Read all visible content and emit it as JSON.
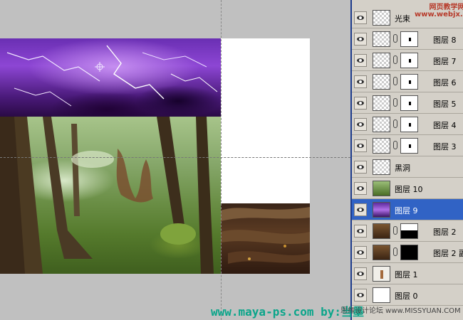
{
  "workspace": {
    "document": "layered composition canvas"
  },
  "layers_panel": {
    "layers": [
      {
        "name": "光束",
        "thumb": "checker",
        "has_mask": false
      },
      {
        "name": "图层 8",
        "thumb": "checker",
        "has_mask": true,
        "mask": "dot"
      },
      {
        "name": "图层 7",
        "thumb": "checker",
        "has_mask": true,
        "mask": "dot"
      },
      {
        "name": "图层 6",
        "thumb": "checker",
        "has_mask": true,
        "mask": "dot"
      },
      {
        "name": "图层 5",
        "thumb": "checker",
        "has_mask": true,
        "mask": "dot"
      },
      {
        "name": "图层 4",
        "thumb": "checker",
        "has_mask": true,
        "mask": "dot"
      },
      {
        "name": "图层 3",
        "thumb": "checker",
        "has_mask": true,
        "mask": "dot"
      },
      {
        "name": "黑洞",
        "thumb": "checker",
        "has_mask": false
      },
      {
        "name": "图层 10",
        "thumb": "forest",
        "has_mask": false
      },
      {
        "name": "图层 9",
        "thumb": "purple",
        "has_mask": false,
        "selected": true
      },
      {
        "name": "图层 2",
        "thumb": "roots",
        "has_mask": true,
        "mask": "black-wave"
      },
      {
        "name": "图层 2 副",
        "thumb": "roots",
        "has_mask": true,
        "mask": "black"
      },
      {
        "name": "图层 1",
        "thumb": "figure",
        "has_mask": false
      },
      {
        "name": "图层 0",
        "thumb": "plain",
        "has_mask": false
      }
    ]
  },
  "watermarks": {
    "top_line1": "网页教学网",
    "top_line2": "www.webjx.com",
    "bottom": "www.maya-ps.com by:当墨",
    "forum": "思缘设计论坛 www.MISSYUAN.COM"
  },
  "colors": {
    "panel_bg": "#d4d0c8",
    "selected": "#3163c5",
    "canvas_bg": "#c0c0c0"
  }
}
